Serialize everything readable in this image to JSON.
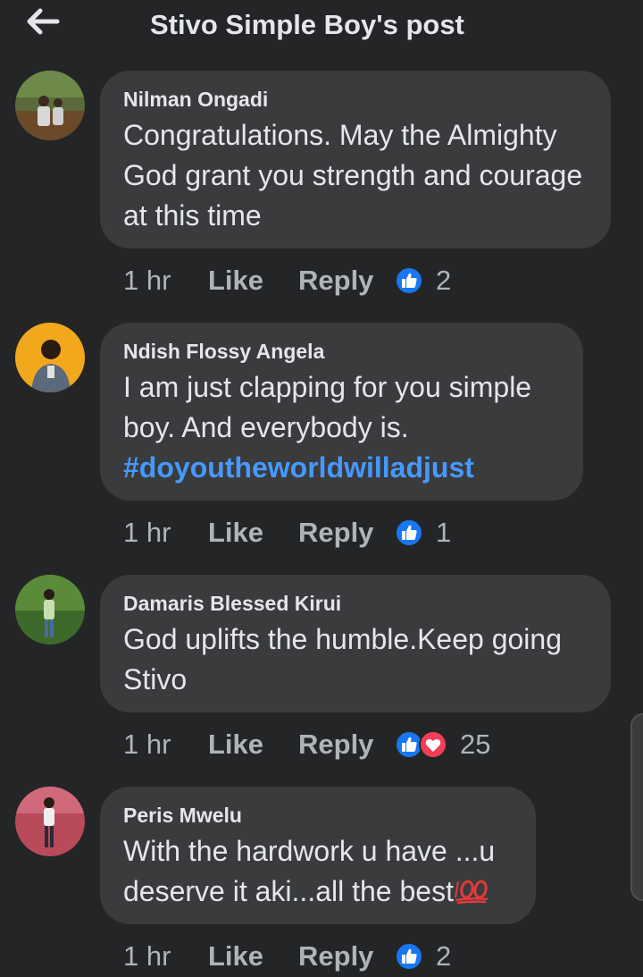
{
  "header": {
    "title": "Stivo Simple Boy's post",
    "back_icon": "arrow-left-icon"
  },
  "comments": [
    {
      "author": "Nilman Ongadi",
      "text": "Congratulations. May the Almighty God grant you strength and courage at this time",
      "time": "1 hr",
      "like_label": "Like",
      "reply_label": "Reply",
      "reactions": [
        "like"
      ],
      "reaction_count": "2"
    },
    {
      "author": "Ndish Flossy Angela",
      "text": "I am just clapping for you simple boy. And everybody is.",
      "hashtag": "#doyoutheworldwilladjust",
      "time": "1 hr",
      "like_label": "Like",
      "reply_label": "Reply",
      "reactions": [
        "like"
      ],
      "reaction_count": "1"
    },
    {
      "author": "Damaris Blessed Kirui",
      "text": "God uplifts the humble.Keep going Stivo",
      "time": "1 hr",
      "like_label": "Like",
      "reply_label": "Reply",
      "reactions": [
        "like",
        "love"
      ],
      "reaction_count": "25"
    },
    {
      "author": "Peris Mwelu",
      "text": "With the hardwork u have ...u deserve it aki...all the best",
      "emoji": "hundred-points-emoji",
      "time": "1 hr",
      "like_label": "Like",
      "reply_label": "Reply",
      "reactions": [
        "like"
      ],
      "reaction_count": "2"
    }
  ],
  "colors": {
    "background": "#242526",
    "bubble": "#3a3b3c",
    "text_primary": "#e4e6eb",
    "text_secondary": "#b0b3b8",
    "hashtag": "#4599ff",
    "like_blue": "#1877f2",
    "love_red": "#f33e58"
  }
}
